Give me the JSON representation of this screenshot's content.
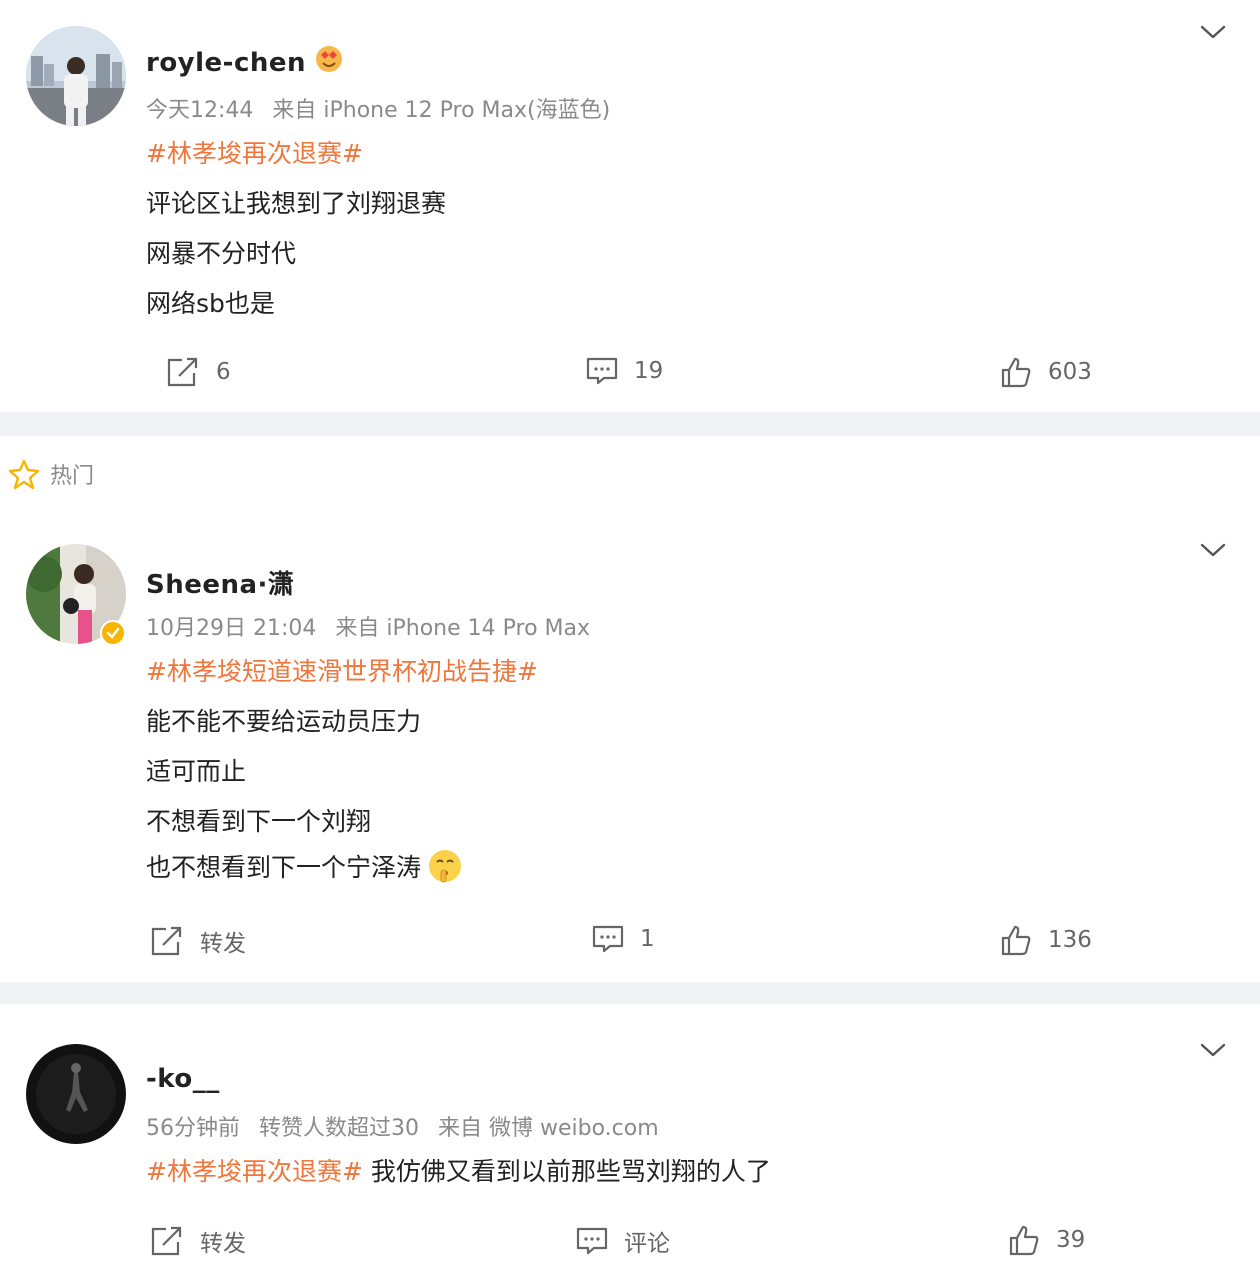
{
  "posts": [
    {
      "username": "royle-chen",
      "time": "今天12:44",
      "source": "来自 iPhone 12 Pro Max(海蓝色)",
      "hashtag": "#林孝埈再次退赛#",
      "lines": [
        "评论区让我想到了刘翔退赛",
        "网暴不分时代",
        "网络sb也是"
      ],
      "repost": "6",
      "comment": "19",
      "like": "603",
      "badge_icon": "emoji-badge-icon"
    },
    {
      "username": "Sheena·潇",
      "time": "10月29日 21:04",
      "source": "来自 iPhone 14 Pro Max",
      "hashtag": "#林孝埈短道速滑世界杯初战告捷#",
      "lines": [
        "能不能不要给运动员压力",
        "适可而止",
        "不想看到下一个刘翔",
        "也不想看到下一个宁泽涛"
      ],
      "repost": "转发",
      "comment": "1",
      "like": "136",
      "verified_icon": "verified-badge-icon"
    },
    {
      "username": "-ko__",
      "time": "56分钟前",
      "extra": "转赞人数超过30",
      "source": "来自 微博 weibo.com",
      "hashtag": "#林孝埈再次退赛#",
      "text": " 我仿佛又看到以前那些骂刘翔的人了",
      "repost": "转发",
      "comment": "评论",
      "like": "39"
    }
  ],
  "hot_section": {
    "label": "热门",
    "icon": "star-icon"
  },
  "colors": {
    "hashtag": "#f0763c",
    "meta": "#8a8a8a",
    "separator": "#f1f2f5",
    "verified": "#f7b500"
  }
}
